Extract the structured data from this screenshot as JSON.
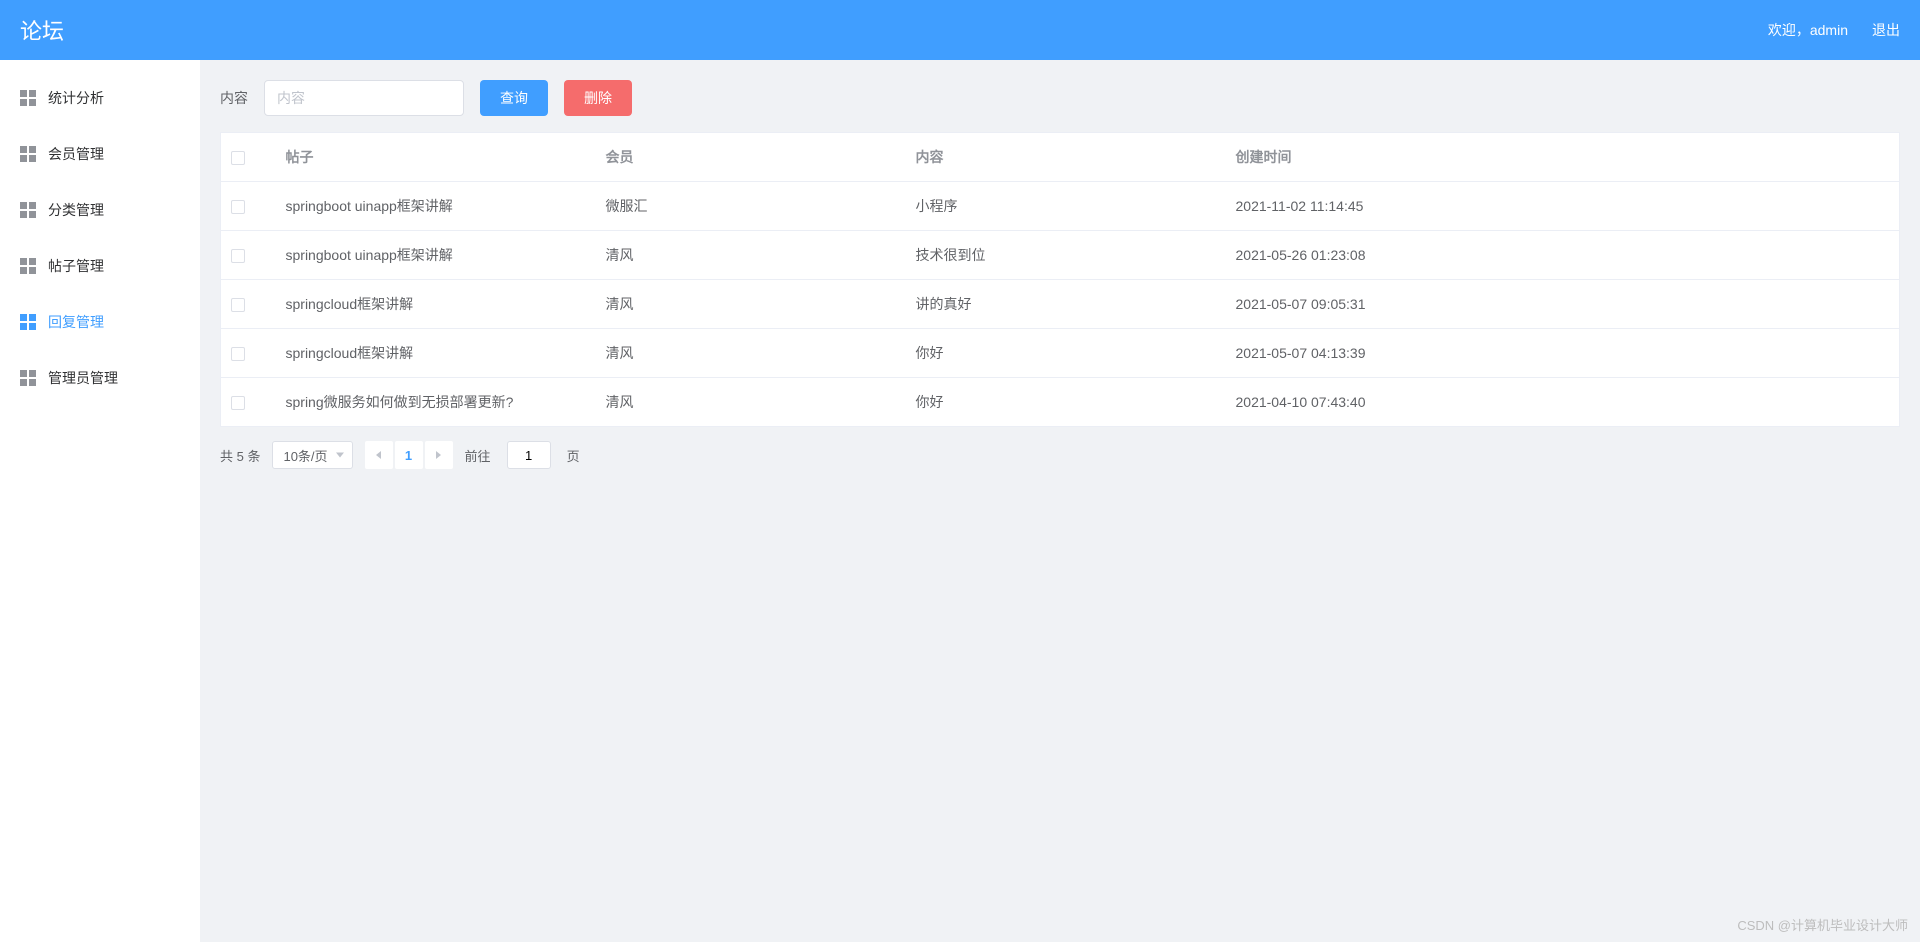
{
  "header": {
    "title": "论坛",
    "welcome": "欢迎，admin",
    "logout": "退出"
  },
  "sidebar": {
    "items": [
      {
        "label": "统计分析"
      },
      {
        "label": "会员管理"
      },
      {
        "label": "分类管理"
      },
      {
        "label": "帖子管理"
      },
      {
        "label": "回复管理"
      },
      {
        "label": "管理员管理"
      }
    ],
    "active_index": 4
  },
  "toolbar": {
    "content_label": "内容",
    "content_placeholder": "内容",
    "search_label": "查询",
    "delete_label": "删除"
  },
  "table": {
    "columns": {
      "post": "帖子",
      "member": "会员",
      "content": "内容",
      "created": "创建时间"
    },
    "rows": [
      {
        "post": "springboot uinapp框架讲解",
        "member": "微服汇",
        "content": "小程序",
        "created": "2021-11-02 11:14:45"
      },
      {
        "post": "springboot uinapp框架讲解",
        "member": "清风",
        "content": "技术很到位",
        "created": "2021-05-26 01:23:08"
      },
      {
        "post": "springcloud框架讲解",
        "member": "清风",
        "content": "讲的真好",
        "created": "2021-05-07 09:05:31"
      },
      {
        "post": "springcloud框架讲解",
        "member": "清风",
        "content": "你好",
        "created": "2021-05-07 04:13:39"
      },
      {
        "post": "spring微服务如何做到无损部署更新?",
        "member": "清风",
        "content": "你好",
        "created": "2021-04-10 07:43:40"
      }
    ]
  },
  "pagination": {
    "total_text": "共 5 条",
    "page_size_label": "10条/页",
    "current_page": "1",
    "goto_prefix": "前往",
    "goto_value": "1",
    "goto_suffix": "页"
  },
  "watermark": "CSDN @计算机毕业设计大师"
}
